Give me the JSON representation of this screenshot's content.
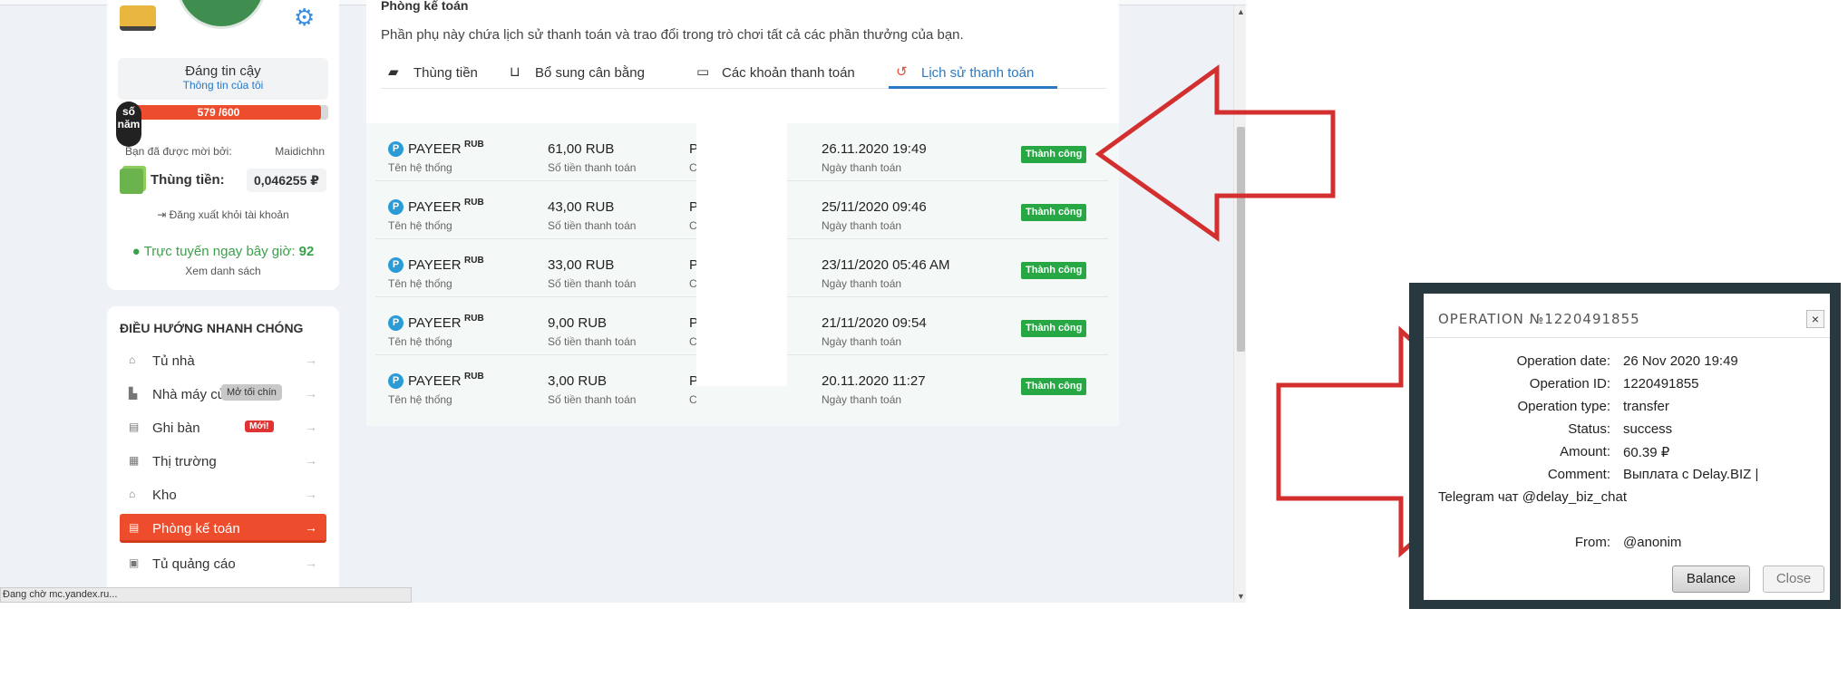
{
  "sidebar": {
    "trust_title": "Đáng tin cậy",
    "trust_link": "Thông tin của tôi",
    "level_badge": "số năm",
    "xp_text": "579 /600",
    "xp_fraction": 0.965,
    "invited_by_label": "Bạn đã được mời bởi:",
    "invited_by_name": "Maidichhn",
    "wallet_label": "Thùng tiền:",
    "wallet_value": "0,046255 ₽",
    "logout": "Đăng xuất khỏi tài khoản",
    "online_label": "Trực tuyến ngay bây giờ:",
    "online_count": "92",
    "see_list": "Xem danh sách"
  },
  "nav": {
    "title": "ĐIỀU HƯỚNG NHANH CHÓNG",
    "items": [
      {
        "label": "Tủ nhà"
      },
      {
        "label": "Nhà máy của tôi",
        "tooltip": "Mở tối chín"
      },
      {
        "label": "Ghi bàn",
        "badge": "Mới!"
      },
      {
        "label": "Thị trường"
      },
      {
        "label": "Kho"
      },
      {
        "label": "Phòng kế toán"
      },
      {
        "label": "Tủ quảng cáo"
      }
    ],
    "arrow": "→"
  },
  "main": {
    "heading": "Phòng kế toán",
    "description": "Phần phụ này chứa lịch sử thanh toán và trao đổi trong trò chơi tất cả các phần thưởng của bạn.",
    "tabs": [
      {
        "label": "Thùng tiền"
      },
      {
        "label": "Bổ sung cân bằng"
      },
      {
        "label": "Các khoản thanh toán"
      },
      {
        "label": "Lịch sử thanh toán"
      }
    ],
    "sub_system": "Tên hệ thống",
    "sub_amount": "Số tiền thanh toán",
    "sub_date": "Ngày thanh toán",
    "rows": [
      {
        "system": "PAYEER",
        "currency": "RUB",
        "amount": "61,00 RUB",
        "account": "P",
        "account_sub": "C",
        "date": "26.11.2020 19:49",
        "status": "Thành công"
      },
      {
        "system": "PAYEER",
        "currency": "RUB",
        "amount": "43,00 RUB",
        "account": "P",
        "account_sub": "C",
        "date": "25/11/2020 09:46",
        "status": "Thành công"
      },
      {
        "system": "PAYEER",
        "currency": "RUB",
        "amount": "33,00 RUB",
        "account": "P",
        "account_sub": "C",
        "date": "23/11/2020 05:46 AM",
        "status": "Thành công"
      },
      {
        "system": "PAYEER",
        "currency": "RUB",
        "amount": "9,00 RUB",
        "account": "P",
        "account_sub": "C",
        "date": "21/11/2020 09:54",
        "status": "Thành công"
      },
      {
        "system": "PAYEER",
        "currency": "RUB",
        "amount": "3,00 RUB",
        "account": "P",
        "account_sub": "C",
        "date": "20.11.2020 11:27",
        "status": "Thành công"
      }
    ]
  },
  "statusbar": "Đang chờ mc.yandex.ru...",
  "dialog": {
    "title": "OPERATION №1220491855",
    "close_x": "×",
    "fields": {
      "date_label": "Operation date:",
      "date": "26 Nov 2020 19:49",
      "id_label": "Operation ID:",
      "id": "1220491855",
      "type_label": "Operation type:",
      "type": "transfer",
      "status_label": "Status:",
      "status": "success",
      "amount_label": "Amount:",
      "amount": "60.39 ₽",
      "comment_label": "Comment:",
      "comment": "Выплата с Delay.BIZ |",
      "comment_cont": "Telegram чат @delay_biz_chat",
      "from_label": "From:",
      "from": "@anonim"
    },
    "balance_button": "Balance",
    "close_button": "Close"
  },
  "colors": {
    "accent_orange": "#ee4d2d",
    "link_blue": "#2b79c2",
    "success_green": "#28a745",
    "annotation_red": "#d32f2f",
    "dialog_frame": "#27383f"
  }
}
